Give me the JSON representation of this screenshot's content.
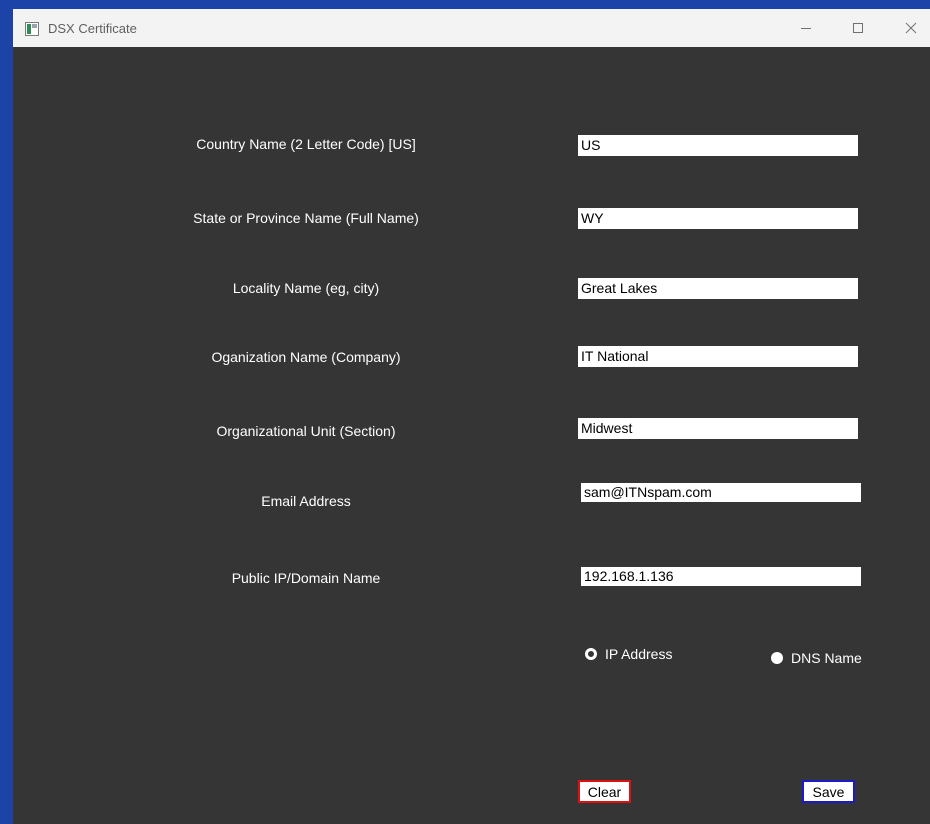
{
  "window": {
    "title": "DSX Certificate",
    "accent_color": "#1c43a8",
    "background_color": "#353535"
  },
  "form": {
    "fields": [
      {
        "label": "Country Name (2 Letter Code) [US]",
        "value": "US"
      },
      {
        "label": "State or Province Name (Full Name)",
        "value": "WY"
      },
      {
        "label": "Locality Name (eg, city)",
        "value": "Great Lakes"
      },
      {
        "label": "Oganization Name (Company)",
        "value": "IT National"
      },
      {
        "label": "Organizational Unit (Section)",
        "value": "Midwest"
      },
      {
        "label": "Email Address",
        "value": "sam@ITNspam.com"
      },
      {
        "label": "Public IP/Domain Name",
        "value": "192.168.1.136"
      }
    ],
    "address_type": {
      "options": [
        "IP Address",
        "DNS Name"
      ],
      "selected": "IP Address"
    }
  },
  "buttons": {
    "clear_label": "Clear",
    "clear_border_color": "#e01010",
    "save_label": "Save",
    "save_border_color": "#1a1acc"
  },
  "icons": {
    "app": "window-app-icon",
    "minimize": "minimize-icon",
    "maximize": "maximize-icon",
    "close": "close-icon"
  }
}
